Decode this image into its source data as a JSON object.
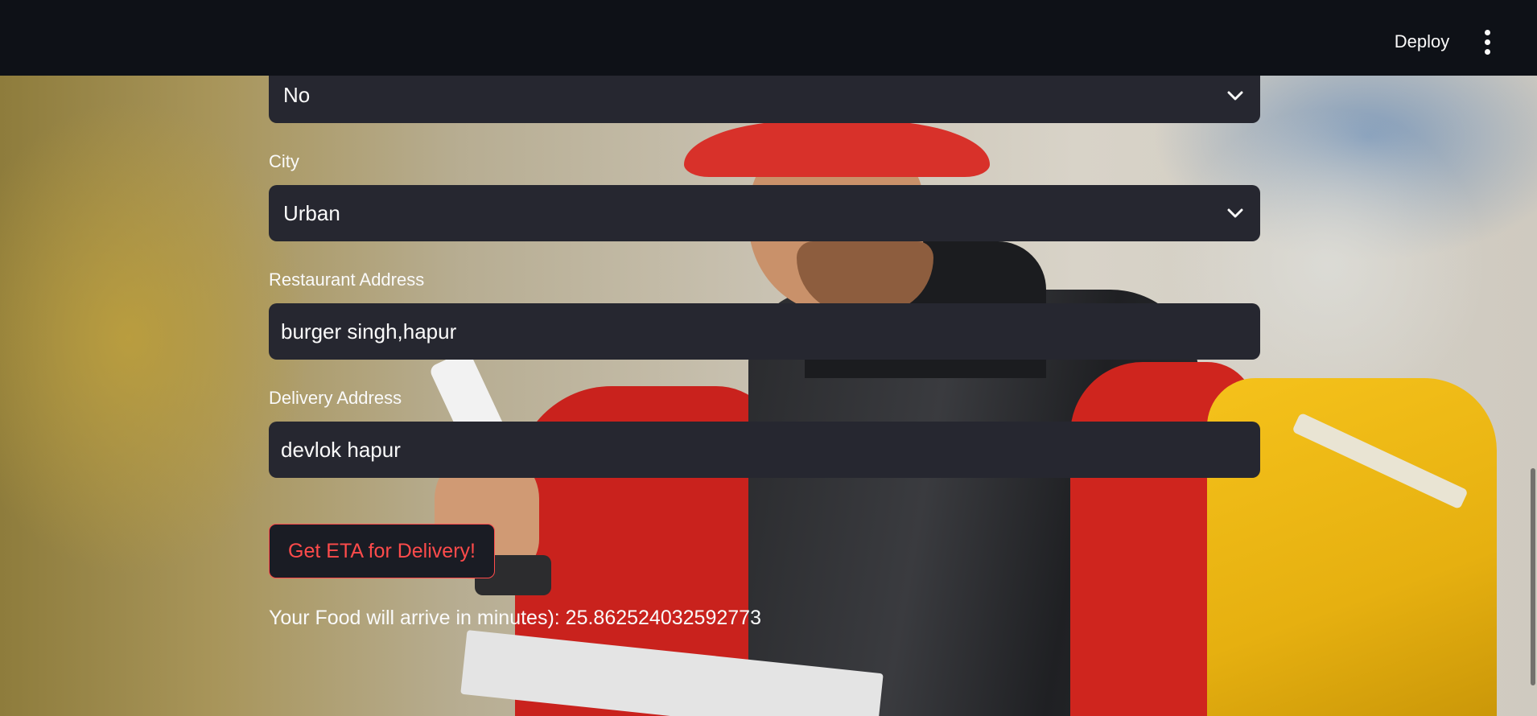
{
  "header": {
    "deploy_label": "Deploy"
  },
  "form": {
    "first_select": {
      "value": "No"
    },
    "city": {
      "label": "City",
      "value": "Urban"
    },
    "restaurant_address": {
      "label": "Restaurant Address",
      "value": "burger singh,hapur"
    },
    "delivery_address": {
      "label": "Delivery Address",
      "value": "devlok hapur"
    },
    "submit_label": "Get ETA for Delivery!",
    "result_text": "Your Food will arrive in minutes): 25.862524032592773"
  },
  "colors": {
    "header_bg": "#0e1117",
    "input_bg": "#262730",
    "accent": "#ff4b4b",
    "text": "#fafafa"
  },
  "icons": {
    "select_chevron": "chevron-down-icon",
    "menu": "kebab-menu-icon"
  }
}
